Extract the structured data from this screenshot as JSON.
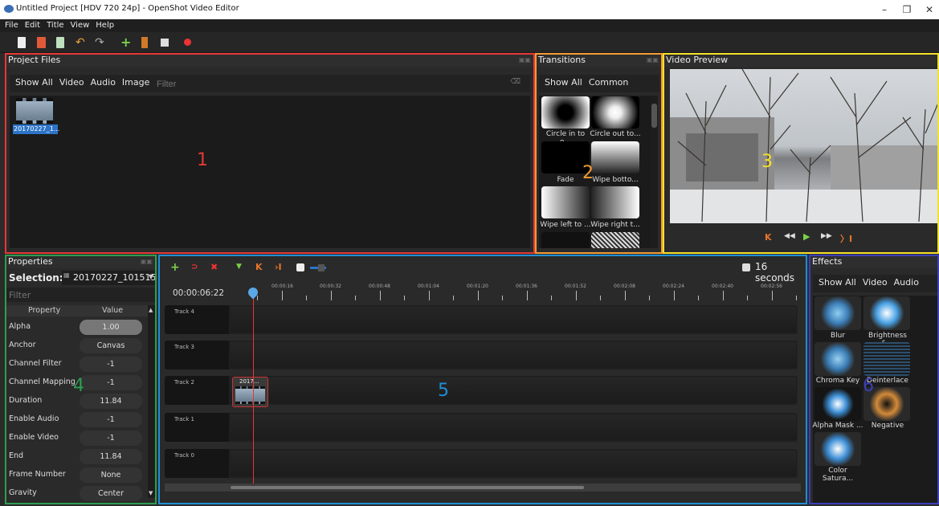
{
  "window": {
    "title": "Untitled Project [HDV 720 24p] - OpenShot Video Editor"
  },
  "menu": [
    "File",
    "Edit",
    "Title",
    "View",
    "Help"
  ],
  "project_files": {
    "header": "Project Files",
    "tabs": [
      "Show All",
      "Video",
      "Audio",
      "Image"
    ],
    "filter_placeholder": "Filter",
    "file_name": "20170227_1...",
    "annotation": "1"
  },
  "transitions": {
    "header": "Transitions",
    "tabs": [
      "Show All",
      "Common"
    ],
    "items": [
      "Circle in to o...",
      "Circle out to...",
      "Fade",
      "Wipe botto...",
      "Wipe left to ...",
      "Wipe right t..."
    ],
    "annotation": "2"
  },
  "video_preview": {
    "header": "Video Preview",
    "annotation": "3"
  },
  "properties": {
    "header": "Properties",
    "selection_label": "Selection:",
    "selection_value": "20170227_101515",
    "filter_placeholder": "Filter",
    "col_property": "Property",
    "col_value": "Value",
    "rows": [
      {
        "name": "Alpha",
        "value": "1.00"
      },
      {
        "name": "Anchor",
        "value": "Canvas"
      },
      {
        "name": "Channel Filter",
        "value": "-1"
      },
      {
        "name": "Channel Mapping",
        "value": "-1"
      },
      {
        "name": "Duration",
        "value": "11.84"
      },
      {
        "name": "Enable Audio",
        "value": "-1"
      },
      {
        "name": "Enable Video",
        "value": "-1"
      },
      {
        "name": "End",
        "value": "11.84"
      },
      {
        "name": "Frame Number",
        "value": "None"
      },
      {
        "name": "Gravity",
        "value": "Center"
      }
    ],
    "annotation": "4"
  },
  "timeline": {
    "zoom_label": "16 seconds",
    "timecode": "00:00:06:22",
    "ruler": [
      "00:00:16",
      "00:00:32",
      "00:00:48",
      "00:01:04",
      "00:01:20",
      "00:01:36",
      "00:01:52",
      "00:02:08",
      "00:02:24",
      "00:02:40",
      "00:02:56"
    ],
    "tracks": [
      "Track 4",
      "Track 3",
      "Track 2",
      "Track 1",
      "Track 0"
    ],
    "clip_label": "2017...",
    "annotation": "5"
  },
  "effects": {
    "header": "Effects",
    "tabs": [
      "Show All",
      "Video",
      "Audio"
    ],
    "items": [
      "Blur",
      "Brightness &...",
      "Chroma Key ...",
      "Deinterlace",
      "Alpha Mask ...",
      "Negative",
      "Color Satura..."
    ],
    "annotation": "6"
  },
  "colors": {
    "frame_project_files": "#e53935",
    "frame_transitions": "#f39c34",
    "frame_preview": "#f5e02a",
    "frame_properties": "#2e9e4f",
    "frame_timeline": "#1e8fd6",
    "frame_effects": "#3b3fb8"
  }
}
